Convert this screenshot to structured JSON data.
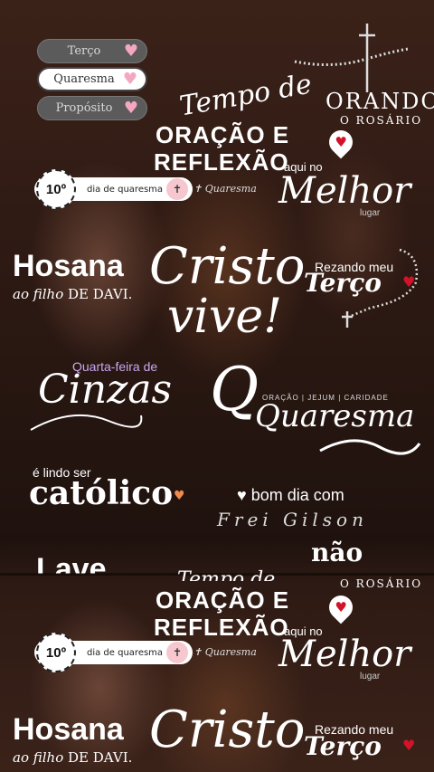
{
  "chips": [
    {
      "label": "Terço",
      "style": "dark"
    },
    {
      "label": "Quaresma",
      "style": "light"
    },
    {
      "label": "Propósito",
      "style": "dark"
    }
  ],
  "stickers": {
    "tempo_de": "Tempo de",
    "oracao": "ORAÇÃO E",
    "reflexao": "REFLEXÃO",
    "day_number": "10º",
    "day_text": "dia de quaresma",
    "day_tag": "Quaresma",
    "orando": "ORANDO",
    "o_rosario": "O ROSÁRIO",
    "aqui_no": "aqui no",
    "melhor": "Melhor",
    "lugar": "lugar",
    "hosana": "Hosana",
    "ao_filho": "ao filho",
    "de_davi": "DE DAVI.",
    "cristo": "Cristo",
    "vive": "vive!",
    "rezando_meu": "Rezando meu",
    "terco": "Terço",
    "quarta_feira": "Quarta-feira de",
    "cinzas": "Cinzas",
    "oracao_jejum": "ORAÇÃO | JEJUM | CARIDADE",
    "quaresma_script": "Quaresma",
    "e_lindo_ser": "é lindo ser",
    "catolico": "católico",
    "bom_dia_com": "bom dia com",
    "frei_gilson": "Frei Gilson",
    "nao_pare": "não pare",
    "lave": "Lave"
  },
  "icons": [
    "heart-icon",
    "pin-heart-icon",
    "rosary-icon",
    "cross-icon"
  ],
  "colors": {
    "accent_pink": "#f4a7c0",
    "accent_red": "#d1132a",
    "lavender": "#c9a7f0"
  }
}
